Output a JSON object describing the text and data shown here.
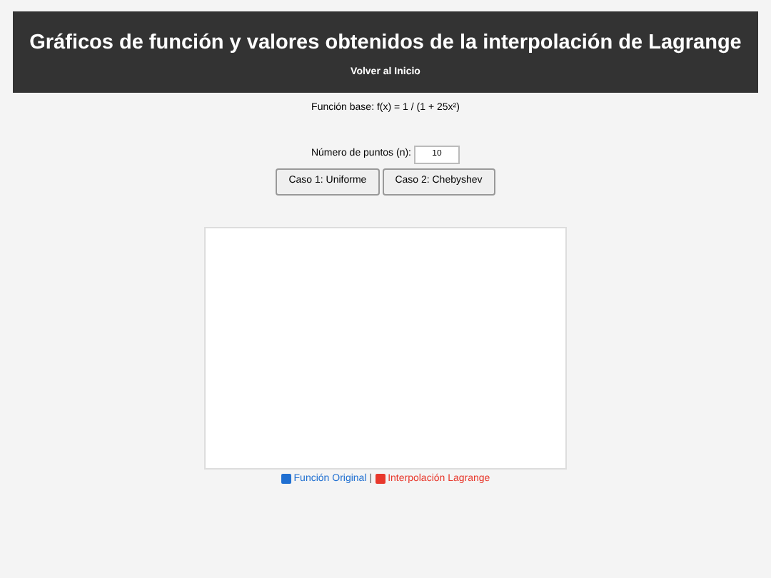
{
  "header": {
    "title": "Gráficos de función y valores obtenidos de la interpolación de Lagrange",
    "link": "Volver al Inicio"
  },
  "base_function": "Función base: f(x) = 1 / (1 + 25x²)",
  "points": {
    "label": "Número de puntos (n):",
    "value": "10"
  },
  "buttons": [
    "Caso 1: Uniforme",
    "Caso 2: Chebyshev"
  ],
  "legend": [
    {
      "label": "Función Original",
      "color": "#1f6fd1"
    },
    {
      "label": "Interpolación Lagrange",
      "color": "#e8382c"
    }
  ],
  "legend_separator": "|"
}
